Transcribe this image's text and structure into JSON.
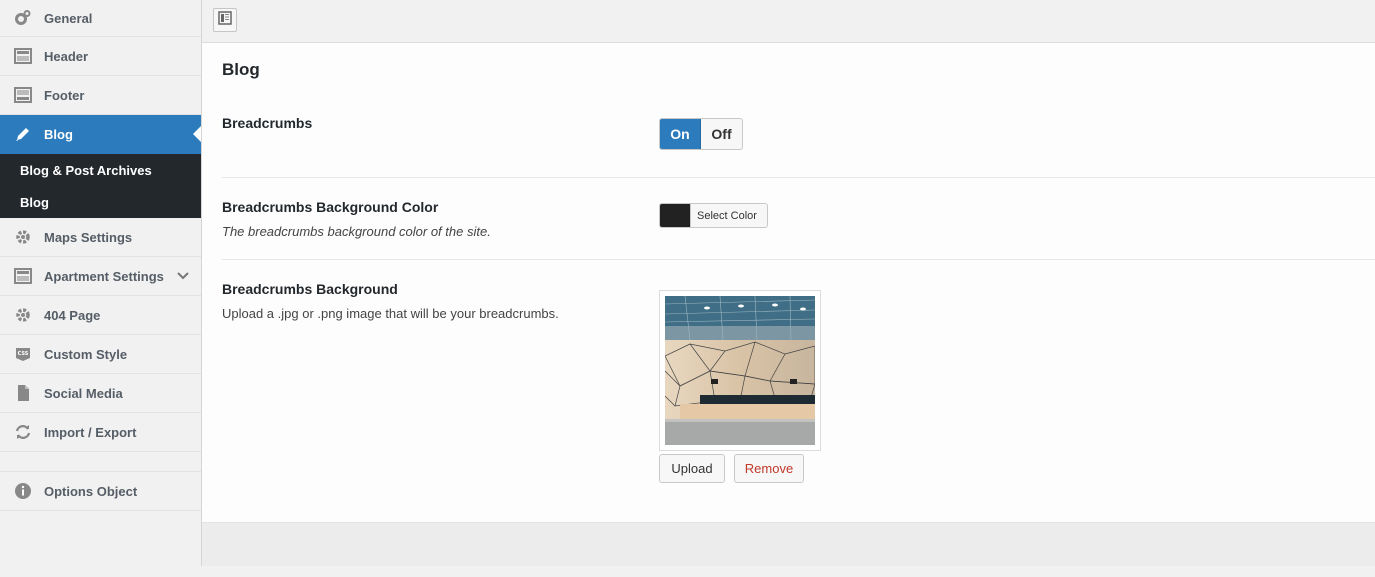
{
  "sidebar": {
    "items": [
      {
        "label": "General",
        "icon": "gears-icon"
      },
      {
        "label": "Header",
        "icon": "layout-icon"
      },
      {
        "label": "Footer",
        "icon": "layout-icon"
      },
      {
        "label": "Blog",
        "icon": "pencil-icon"
      },
      {
        "label": "Maps Settings",
        "icon": "gear-icon"
      },
      {
        "label": "Apartment Settings",
        "icon": "layout-icon"
      },
      {
        "label": "404 Page",
        "icon": "gear-icon"
      },
      {
        "label": "Custom Style",
        "icon": "css-icon"
      },
      {
        "label": "Social Media",
        "icon": "file-icon"
      },
      {
        "label": "Import / Export",
        "icon": "refresh-icon"
      },
      {
        "label": "Options Object",
        "icon": "info-icon"
      }
    ],
    "submenu": [
      "Blog & Post Archives",
      "Blog"
    ]
  },
  "main": {
    "section_title": "Blog",
    "breadcrumbs": {
      "label": "Breadcrumbs",
      "on_label": "On",
      "off_label": "Off",
      "value": "On"
    },
    "bg_color": {
      "label": "Breadcrumbs Background Color",
      "description": "The breadcrumbs background color of the site.",
      "button_label": "Select Color",
      "swatch_color": "#222222"
    },
    "bg_image": {
      "label": "Breadcrumbs Background",
      "description": "Upload a .jpg or .png image that will be your breadcrumbs.",
      "upload_label": "Upload",
      "remove_label": "Remove"
    }
  },
  "colors": {
    "accent": "#2b7bbd",
    "danger": "#c0392b",
    "submenu_bg": "#23282d"
  }
}
